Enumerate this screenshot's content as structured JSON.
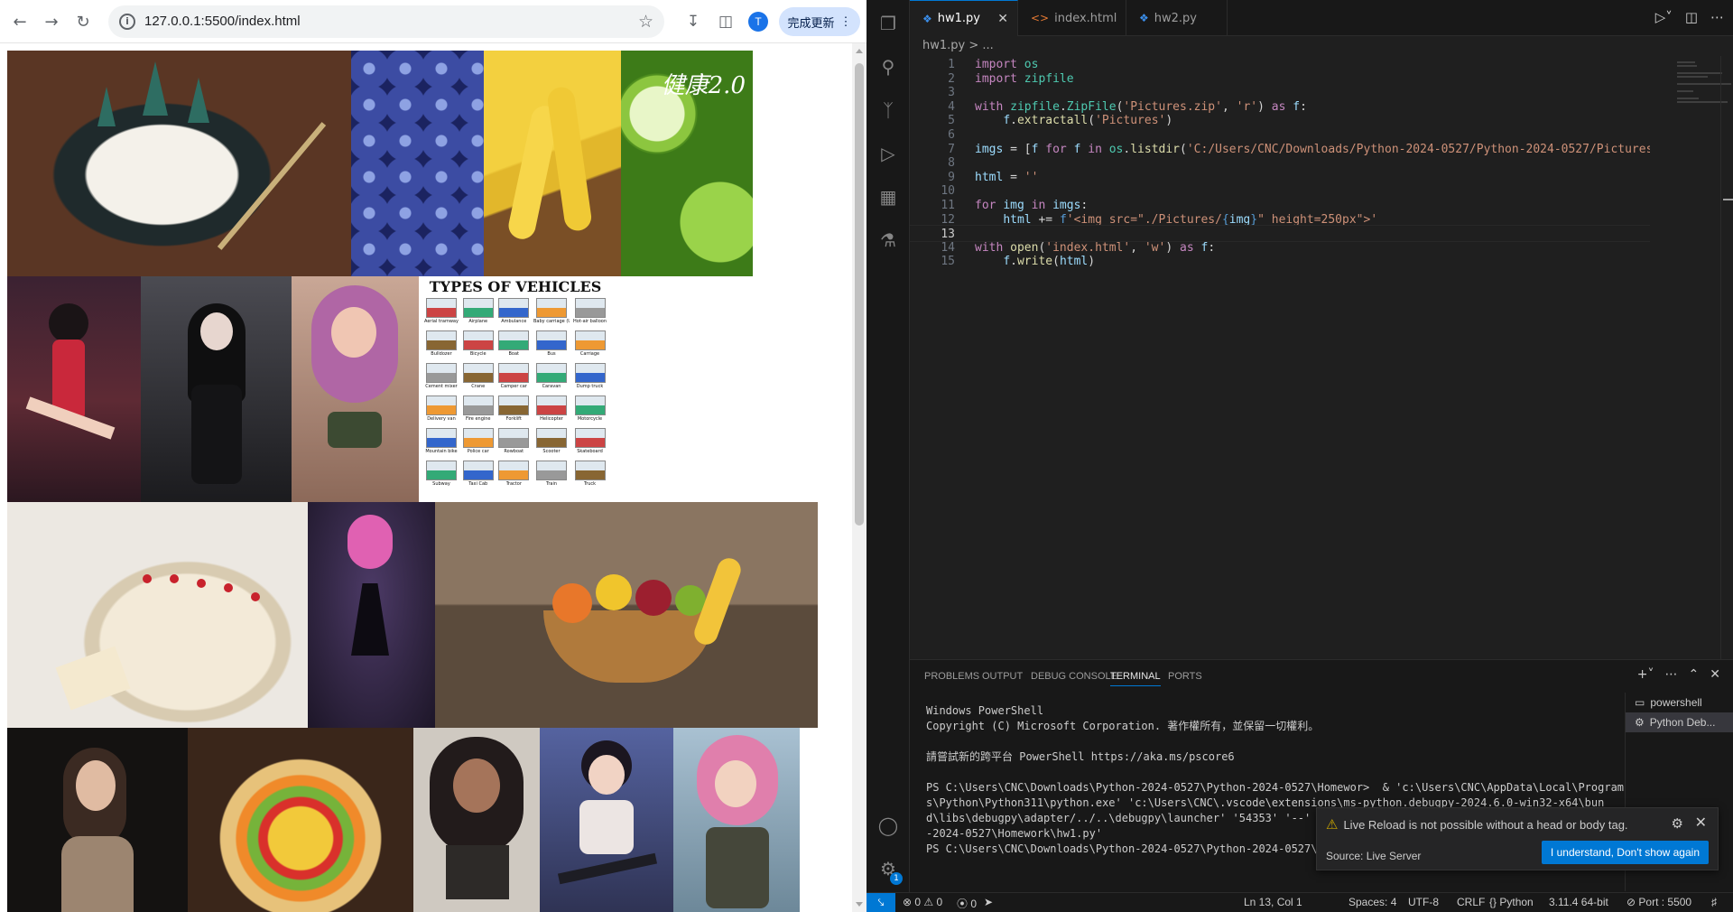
{
  "browser": {
    "url": "127.0.0.1:5500/index.html",
    "avatar_letter": "T",
    "update_label": "完成更新",
    "images": [
      {
        "name": "christmas-cake",
        "bg": "#5a3624",
        "accent": "#e9e6df"
      },
      {
        "name": "blueberries",
        "bg": "#3b4a9e",
        "accent": "#7f93d8"
      },
      {
        "name": "bananas",
        "bg": "#d9a928",
        "accent": "#6b4420"
      },
      {
        "name": "limes",
        "bg": "#7cbd2d",
        "accent": "#c4e38a"
      },
      {
        "name": "anime-girl-red-dress",
        "bg": "#3a2130",
        "accent": "#c2283b"
      },
      {
        "name": "anime-girl-black-dress",
        "bg": "#2f2f33",
        "accent": "#c9c1bd"
      },
      {
        "name": "anime-girl-purple-hair",
        "bg": "#ad8678",
        "accent": "#b567a8"
      },
      {
        "name": "types-of-vehicles-chart",
        "bg": "#ffffff",
        "accent": "#333333"
      },
      {
        "name": "strawberry-cream-cake",
        "bg": "#ece8e2",
        "accent": "#d6c8ad"
      },
      {
        "name": "anime-girl-pink-hair-dress",
        "bg": "#231b33",
        "accent": "#d05ca8"
      },
      {
        "name": "fruit-basket",
        "bg": "#6e5b48",
        "accent": "#e8a132"
      },
      {
        "name": "woman-portrait",
        "bg": "#151312",
        "accent": "#8a6c56"
      },
      {
        "name": "fruit-tart",
        "bg": "#3f2b20",
        "accent": "#e3b84a"
      },
      {
        "name": "anime-girl-curly-hair",
        "bg": "#c8c3bb",
        "accent": "#2a2222"
      },
      {
        "name": "anime-girl-buns",
        "bg": "#4a5580",
        "accent": "#e6dfdd"
      },
      {
        "name": "anime-girl-pink-camo",
        "bg": "#8ba7bc",
        "accent": "#d87ca3"
      }
    ],
    "lime_caption": "健康2.0",
    "vehicles_title": "TYPES OF VEHICLES",
    "vehicles_labels": [
      "Aerial tramway",
      "Airplane",
      "Ambulance",
      "Baby carriage (US)",
      "Hot-air balloon",
      "Bulldozer",
      "Bicycle",
      "Boat",
      "Bus",
      "Carriage",
      "Cement mixer",
      "Crane",
      "Camper car",
      "Caravan",
      "Dump truck",
      "Delivery van",
      "Fire engine",
      "Forklift",
      "Helicopter",
      "Motorcycle",
      "Mountain bike",
      "Police car",
      "Rowboat",
      "Scooter",
      "Skateboard",
      "Subway",
      "Taxi Cab",
      "Tractor",
      "Train",
      "Truck"
    ]
  },
  "vscode": {
    "tabs": [
      {
        "label": "hw1.py",
        "icon": "python-icon"
      },
      {
        "label": "index.html",
        "icon": "html-icon"
      },
      {
        "label": "hw2.py",
        "icon": "python-icon"
      }
    ],
    "breadcrumb": "hw1.py > ...",
    "code": [
      [
        [
          "kw",
          "import"
        ],
        [
          "tx",
          " "
        ],
        [
          "cl",
          "os"
        ]
      ],
      [
        [
          "kw",
          "import"
        ],
        [
          "tx",
          " "
        ],
        [
          "cl",
          "zipfile"
        ]
      ],
      [],
      [
        [
          "kw",
          "with"
        ],
        [
          "tx",
          " "
        ],
        [
          "cl",
          "zipfile"
        ],
        [
          "tx",
          "."
        ],
        [
          "cl",
          "ZipFile"
        ],
        [
          "tx",
          "("
        ],
        [
          "st",
          "'Pictures.zip'"
        ],
        [
          "tx",
          ", "
        ],
        [
          "st",
          "'r'"
        ],
        [
          "tx",
          ") "
        ],
        [
          "kw",
          "as"
        ],
        [
          "tx",
          " "
        ],
        [
          "vr",
          "f"
        ],
        [
          "tx",
          ":"
        ]
      ],
      [
        [
          "tx",
          "    "
        ],
        [
          "vr",
          "f"
        ],
        [
          "tx",
          "."
        ],
        [
          "fn",
          "extractall"
        ],
        [
          "tx",
          "("
        ],
        [
          "st",
          "'Pictures'"
        ],
        [
          "tx",
          ")"
        ]
      ],
      [],
      [
        [
          "vr",
          "imgs"
        ],
        [
          "tx",
          " = ["
        ],
        [
          "vr",
          "f"
        ],
        [
          "tx",
          " "
        ],
        [
          "kw",
          "for"
        ],
        [
          "tx",
          " "
        ],
        [
          "vr",
          "f"
        ],
        [
          "tx",
          " "
        ],
        [
          "kw",
          "in"
        ],
        [
          "tx",
          " "
        ],
        [
          "cl",
          "os"
        ],
        [
          "tx",
          "."
        ],
        [
          "fn",
          "listdir"
        ],
        [
          "tx",
          "("
        ],
        [
          "st",
          "'C:/Users/CNC/Downloads/Python-2024-0527/Python-2024-0527/Pictures"
        ]
      ],
      [],
      [
        [
          "vr",
          "html"
        ],
        [
          "tx",
          " = "
        ],
        [
          "st",
          "''"
        ]
      ],
      [],
      [
        [
          "kw",
          "for"
        ],
        [
          "tx",
          " "
        ],
        [
          "vr",
          "img"
        ],
        [
          "tx",
          " "
        ],
        [
          "kw",
          "in"
        ],
        [
          "tx",
          " "
        ],
        [
          "vr",
          "imgs"
        ],
        [
          "tx",
          ":"
        ]
      ],
      [
        [
          "tx",
          "    "
        ],
        [
          "vr",
          "html"
        ],
        [
          "tx",
          " += "
        ],
        [
          "kb",
          "f"
        ],
        [
          "st",
          "'<img src=\"./Pictures/"
        ],
        [
          "kb",
          "{"
        ],
        [
          "vr",
          "img"
        ],
        [
          "kb",
          "}"
        ],
        [
          "st",
          "\" height=250px\">'"
        ]
      ],
      [],
      [
        [
          "kw",
          "with"
        ],
        [
          "tx",
          " "
        ],
        [
          "fn",
          "open"
        ],
        [
          "tx",
          "("
        ],
        [
          "st",
          "'index.html'"
        ],
        [
          "tx",
          ", "
        ],
        [
          "st",
          "'w'"
        ],
        [
          "tx",
          ") "
        ],
        [
          "kw",
          "as"
        ],
        [
          "tx",
          " "
        ],
        [
          "vr",
          "f"
        ],
        [
          "tx",
          ":"
        ]
      ],
      [
        [
          "tx",
          "    "
        ],
        [
          "vr",
          "f"
        ],
        [
          "tx",
          "."
        ],
        [
          "fn",
          "write"
        ],
        [
          "tx",
          "("
        ],
        [
          "vr",
          "html"
        ],
        [
          "tx",
          ")"
        ]
      ]
    ],
    "current_line": 13,
    "panel_tabs": [
      "PROBLEMS",
      "OUTPUT",
      "DEBUG CONSOLE",
      "TERMINAL",
      "PORTS"
    ],
    "active_panel_tab": "TERMINAL",
    "terminal": [
      "Windows PowerShell",
      "Copyright (C) Microsoft Corporation. 著作權所有，並保留一切權利。",
      "",
      "請嘗試新的跨平台 PowerShell https://aka.ms/pscore6",
      "",
      "PS C:\\Users\\CNC\\Downloads\\Python-2024-0527\\Python-2024-0527\\Homewor>  & 'c:\\Users\\CNC\\AppData\\Local\\Program",
      "s\\Python\\Python311\\python.exe' 'c:\\Users\\CNC\\.vscode\\extensions\\ms-python.debugpy-2024.6.0-win32-x64\\bun",
      "d\\libs\\debugpy\\adapter/../..\\debugpy\\launcher' '54353' '--' 'c:\\Users\\CNC\\Downloads\\Python-2024-0527\\Python",
      "-2024-0527\\Homework\\hw1.py'",
      "PS C:\\Users\\CNC\\Downloads\\Python-2024-0527\\Python-2024-0527\\Homewor"
    ],
    "terminal_list": [
      "powershell",
      "Python Deb..."
    ],
    "toast": {
      "message": "Live Reload is not possible without a head or body tag.",
      "source": "Source: Live Server",
      "button": "I understand, Don't show again"
    },
    "status": {
      "errors": "0",
      "warnings": "0",
      "ports": "0",
      "position": "Ln 13, Col 1",
      "spaces": "Spaces: 4",
      "encoding": "UTF-8",
      "eol": "CRLF",
      "language": "Python",
      "interpreter": "3.11.4 64-bit",
      "port": "Port : 5500",
      "settings_badge": "1"
    }
  }
}
